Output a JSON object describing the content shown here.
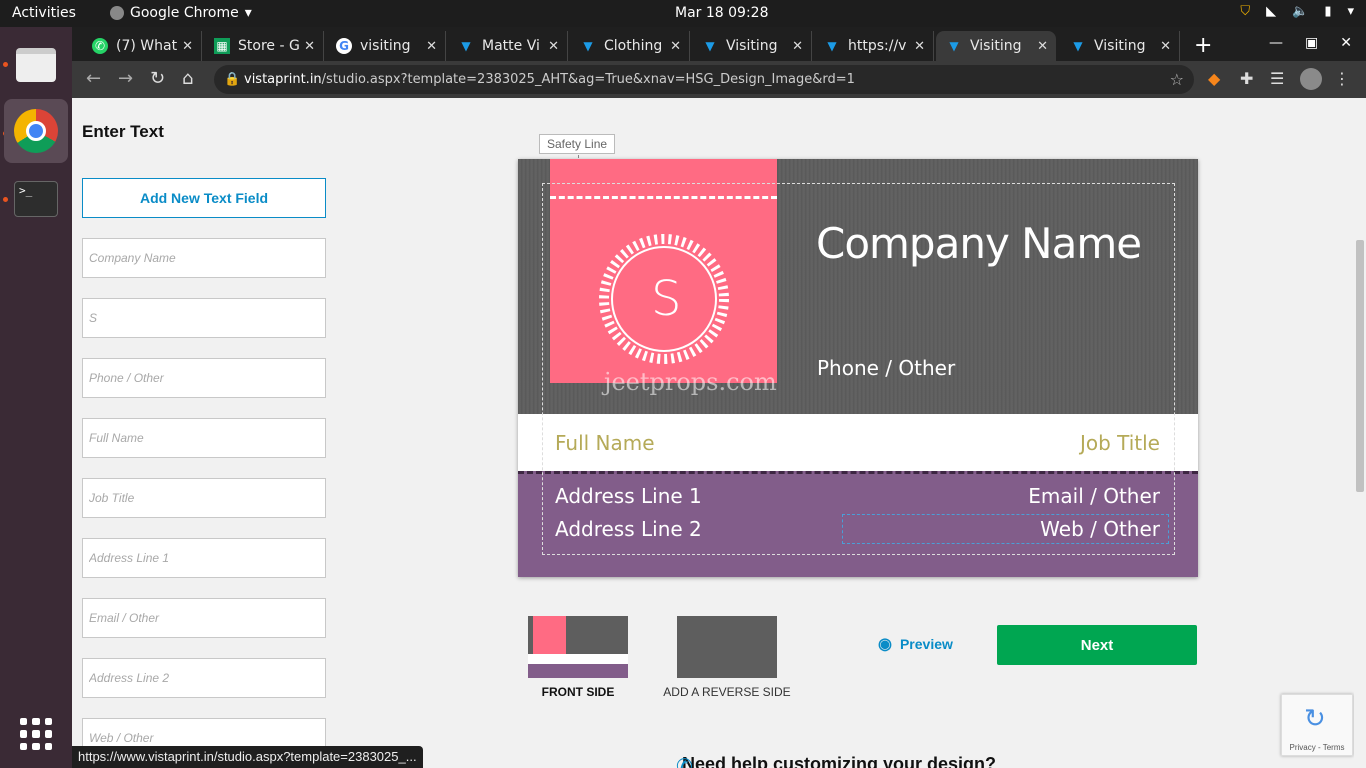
{
  "system": {
    "activities": "Activities",
    "app_name": "Google Chrome",
    "clock": "Mar 18  09:28"
  },
  "tabs": [
    {
      "title": "(7) What",
      "icon": "whatsapp-icon"
    },
    {
      "title": "Store - G",
      "icon": "sheets-icon"
    },
    {
      "title": "visiting",
      "icon": "google-icon"
    },
    {
      "title": "Matte Vi",
      "icon": "vistaprint-icon"
    },
    {
      "title": "Clothing",
      "icon": "vistaprint-icon"
    },
    {
      "title": "Visiting",
      "icon": "vistaprint-icon"
    },
    {
      "title": "https://v",
      "icon": "vistaprint-icon"
    },
    {
      "title": "Visiting",
      "icon": "vistaprint-icon"
    },
    {
      "title": "Visiting",
      "icon": "vistaprint-icon"
    }
  ],
  "address_bar": {
    "host": "vistaprint.in",
    "path": "/studio.aspx?template=2383025_AHT&ag=True&xnav=HSG_Design_Image&rd=1"
  },
  "panel": {
    "title": "Enter Text",
    "add_button": "Add New Text Field",
    "fields": [
      {
        "placeholder": "Company Name"
      },
      {
        "placeholder": "S"
      },
      {
        "placeholder": "Phone / Other"
      },
      {
        "placeholder": "Full Name"
      },
      {
        "placeholder": "Job Title"
      },
      {
        "placeholder": "Address Line 1"
      },
      {
        "placeholder": "Email / Other"
      },
      {
        "placeholder": "Address Line 2"
      },
      {
        "placeholder": "Web / Other"
      }
    ]
  },
  "card": {
    "safety_line": "Safety Line",
    "company_name": "Company Name",
    "monogram": "S",
    "phone": "Phone / Other",
    "full_name": "Full Name",
    "job_title": "Job Title",
    "address1": "Address Line 1",
    "address2": "Address Line 2",
    "email": "Email / Other",
    "web": "Web / Other",
    "watermark": "jeetprops.com",
    "colors": {
      "pink": "#ff6b83",
      "gray": "#5e5e5e",
      "purple": "#825d8a",
      "olive": "#b5aa58"
    }
  },
  "sides": {
    "front": "FRONT SIDE",
    "reverse": "ADD A REVERSE SIDE"
  },
  "actions": {
    "preview": "Preview",
    "next": "Next"
  },
  "help_text": "Need help customizing your design?",
  "recaptcha": "Privacy - Terms",
  "status_url": "https://www.vistaprint.in/studio.aspx?template=2383025_..."
}
